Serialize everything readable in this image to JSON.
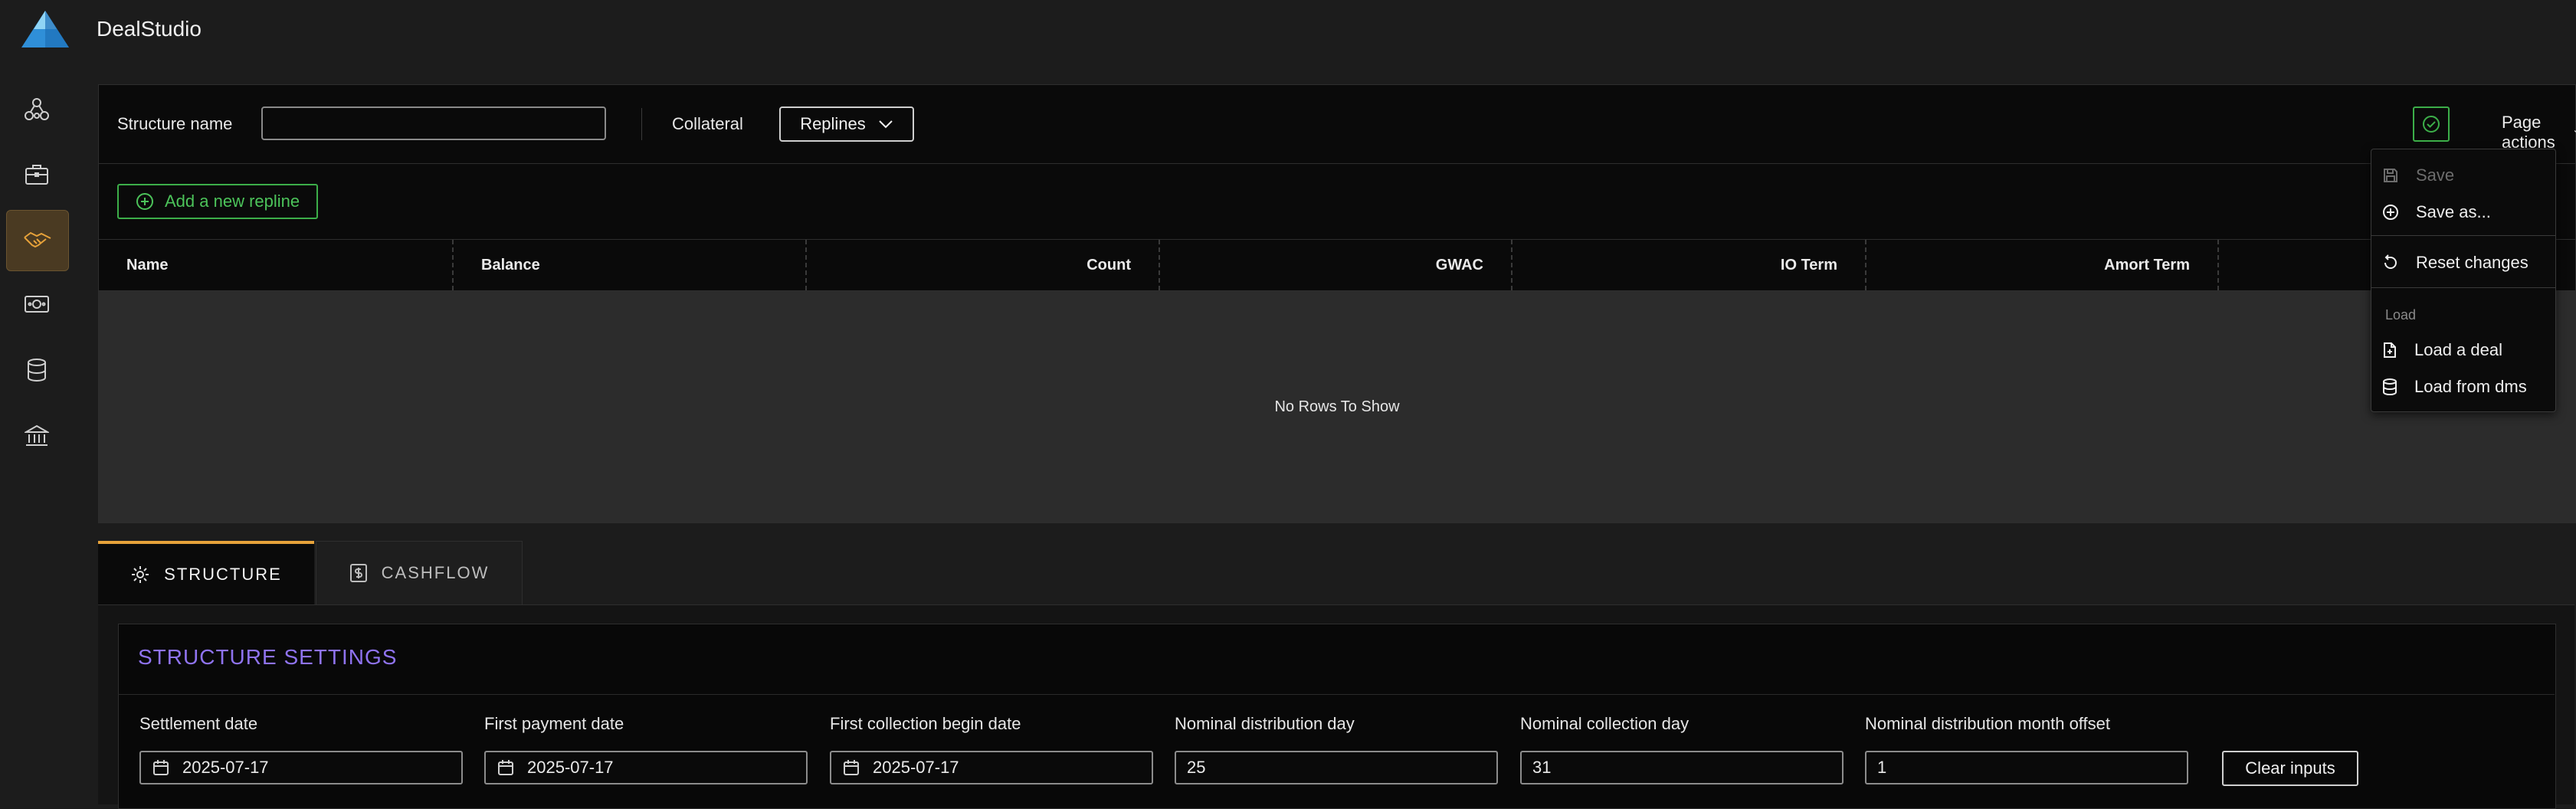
{
  "app": {
    "title": "DealStudio"
  },
  "sidebar": {
    "items": [
      {
        "icon": "network-icon",
        "active": false
      },
      {
        "icon": "briefcase-icon",
        "active": false
      },
      {
        "icon": "handshake-icon",
        "active": true
      },
      {
        "icon": "cash-icon",
        "active": false
      },
      {
        "icon": "database-icon",
        "active": false
      },
      {
        "icon": "bank-icon",
        "active": false
      }
    ]
  },
  "toolbar": {
    "structure_name_label": "Structure name",
    "structure_name_value": "",
    "collateral_label": "Collateral",
    "collateral_selected": "Replines",
    "page_actions_label": "Page actions"
  },
  "replines": {
    "add_button": "Add a new repline",
    "columns": [
      "Name",
      "Balance",
      "Count",
      "GWAC",
      "IO Term",
      "Amort Term"
    ],
    "empty_message": "No Rows To Show"
  },
  "page_actions_menu": {
    "save": "Save",
    "save_as": "Save as...",
    "reset": "Reset changes",
    "load_heading": "Load",
    "load_deal": "Load a deal",
    "load_dms": "Load from dms"
  },
  "tabs": [
    {
      "label": "STRUCTURE",
      "active": true
    },
    {
      "label": "CASHFLOW",
      "active": false
    }
  ],
  "structure_settings": {
    "title": "STRUCTURE SETTINGS",
    "fields": [
      {
        "label": "Settlement date",
        "value": "2025-07-17"
      },
      {
        "label": "First payment date",
        "value": "2025-07-17"
      },
      {
        "label": "First collection begin date",
        "value": "2025-07-17"
      },
      {
        "label": "Nominal distribution day",
        "value": "25"
      },
      {
        "label": "Nominal collection day",
        "value": "31"
      },
      {
        "label": "Nominal distribution month offset",
        "value": "1"
      }
    ],
    "clear_button": "Clear inputs"
  },
  "colors": {
    "accent_orange": "#e7a23a",
    "accent_green": "#3cae49",
    "title_purple": "#8f73f0"
  }
}
